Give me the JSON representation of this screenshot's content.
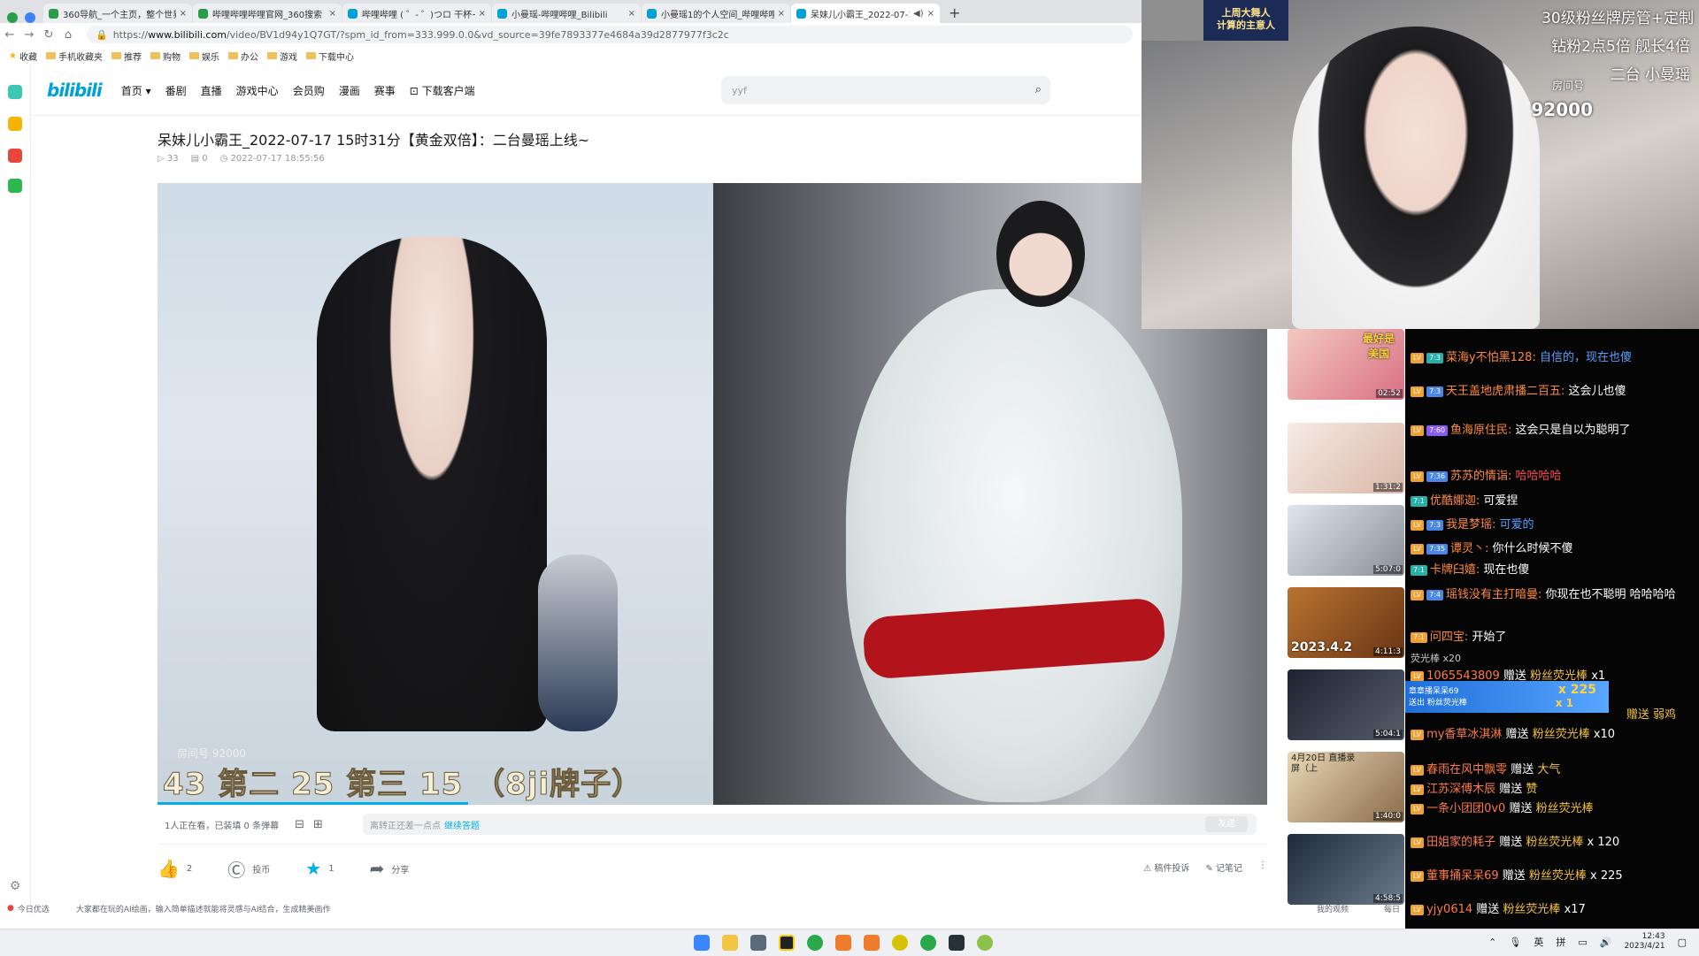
{
  "browser": {
    "tabs": [
      {
        "label": "360导航_一个主页，整个世界",
        "color": "#2a9d4b"
      },
      {
        "label": "哔哩哔哩哔哩官网_360搜索",
        "color": "#2a9d4b"
      },
      {
        "label": "哔哩哔哩 ( ゜- ゜)つロ 干杯~-",
        "color": "#00a1d6"
      },
      {
        "label": "小曼瑶-哔哩哔哩_Bilibili",
        "color": "#00a1d6"
      },
      {
        "label": "小曼瑶1的个人空间_哔哩哔哩",
        "color": "#00a1d6"
      },
      {
        "label": "呆妹儿小霸王_2022-07-17",
        "color": "#00a1d6",
        "active": true
      }
    ],
    "close_glyph": "×",
    "newtab_glyph": "+",
    "url_prefix": "https://",
    "url_domain": "www.bilibili.com",
    "url_path": "/video/BV1d94y1Q7GT/?spm_id_from=333.999.0.0&vd_source=39fe7893377e4684a39d2877977f3c2c",
    "bookmarks": [
      "收藏",
      "手机收藏夹",
      "推荐",
      "购物",
      "娱乐",
      "办公",
      "游戏",
      "下载中心"
    ]
  },
  "site_header": {
    "logo": "bilibili",
    "nav": [
      "首页",
      "番剧",
      "直播",
      "游戏中心",
      "会员购",
      "漫画",
      "赛事",
      "下载客户端"
    ],
    "search_value": "yyf",
    "search_icon": "search-icon"
  },
  "video": {
    "title": "呆妹儿小霸王_2022-07-17 15时31分【黄金双倍】：二台曼瑶上线~",
    "views": "33",
    "danmaku": "0",
    "date": "2022-07-17 18:55:56",
    "overlay_text": "43 第二 25 第三 15 （8ji牌子）",
    "overlay_sub": "房间号 92000",
    "progress": 0.28
  },
  "danmaku_bar": {
    "watching": "1人正在看，已装填 0 条弹幕",
    "placeholder": "离转正还差一点点",
    "link": "继续答题",
    "send": "发送"
  },
  "actions": {
    "like_count": "2",
    "coin_label": "投币",
    "fav_count": "1",
    "share_label": "分享",
    "report": "稿件投诉",
    "notes": "记笔记",
    "more": "⋮"
  },
  "bottom_strip": {
    "left": "今日优选",
    "ad": "大家都在玩的AI绘画，输入简单描述就能将灵感与AI结合，生成精美画作",
    "right1": "我的观频",
    "right2": "每日"
  },
  "recommend_durations": [
    "02:52",
    "1:31:2",
    "5:07:0",
    "4:11:3",
    "5:04:1",
    "1:40:0",
    "4:58:5"
  ],
  "thumb_captions": {
    "t1": "最好是 美国",
    "t4": "2023.4.2",
    "t6": "4月20日 直播录屏（上"
  },
  "stream": {
    "line1": "30级粉丝牌房管+定制",
    "line2": "钻粉2点5倍 舰长4倍",
    "line3": "二台 小曼瑶",
    "room_label": "房间号",
    "room_number": "92000",
    "logo_text1": "上周大舞人",
    "logo_text2": "计算的主意人"
  },
  "chat": {
    "messages": [
      {
        "user": "菜海y不怕黑128:",
        "text": " 自信的，现在也傻",
        "badge": "7:3"
      },
      {
        "user": "天王盖地虎肃播二百五:",
        "text": " 这会儿也傻",
        "badge": "7:3"
      },
      {
        "user": "鱼海原住民:",
        "text": " 这会只是自以为聪明了",
        "badge": "7:60"
      },
      {
        "user": "苏苏的情诣:",
        "text": " 哈哈哈哈",
        "badge": "7:36"
      },
      {
        "user": "优酷娜迦:",
        "text": " 可爱捏",
        "badge": "7:1"
      },
      {
        "user": "我是梦瑶:",
        "text": " 可爱的",
        "badge": "7:3"
      },
      {
        "user": "谭灵丶:",
        "text": " 你什么时候不傻",
        "badge": "7:35"
      },
      {
        "user": "卡牌臼嬉:",
        "text": " 现在也傻",
        "badge": "7:1"
      },
      {
        "user": "瑶钱没有主打暗曼:",
        "text": " 你现在也不聪明 哈哈哈哈",
        "badge": "7:4"
      },
      {
        "user": "问四宝:",
        "text": " 开始了",
        "badge": "7:1"
      }
    ],
    "gifts": [
      {
        "user": "1065543809",
        "action": " 赠送 ",
        "gift": "粉丝荧光棒",
        "count": " x1"
      },
      {
        "user": "my香草冰淇淋",
        "action": " 赠送 ",
        "gift": "粉丝荧光棒",
        "count": " x10"
      },
      {
        "user": "春雨在风中飘零",
        "action": " 赠送 ",
        "gift": "大气",
        "count": ""
      },
      {
        "user": "江苏深傅木辰",
        "action": " 赠送 ",
        "gift": "赞",
        "count": ""
      },
      {
        "user": "一条小团团0v0",
        "action": " 赠送 ",
        "gift": "粉丝荧光棒",
        "count": ""
      },
      {
        "user": "田姐家的耗子",
        "action": " 赠送 ",
        "gift": "粉丝荧光棒",
        "count": " x 120"
      },
      {
        "user": "董事捅呆呆69",
        "action": " 赠送 ",
        "gift": "粉丝荧光棒",
        "count": " x 225"
      },
      {
        "user": "yjy0614",
        "action": " 赠送 ",
        "gift": "粉丝荧光棒",
        "count": " x17"
      }
    ],
    "top_gift": "荧光棒 x20",
    "banner_line1": "章章播呆呆69",
    "banner_line2": "送出  粉丝荧光棒",
    "banner_count": "x 225",
    "banner_sub": "x 1",
    "partial_gift": "赠送 弱鸡"
  },
  "taskbar": {
    "tray_ime1": "英",
    "tray_ime2": "拼",
    "time": "12:43",
    "date": "2023/4/21"
  }
}
